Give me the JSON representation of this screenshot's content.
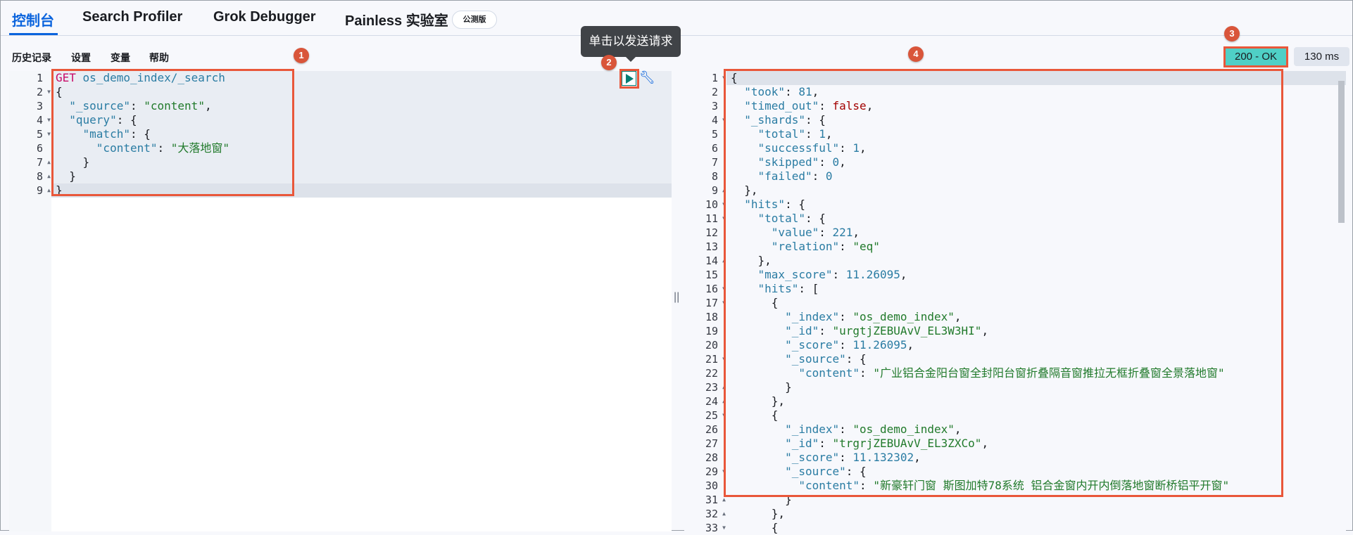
{
  "tabs": [
    {
      "label": "控制台"
    },
    {
      "label": "Search Profiler"
    },
    {
      "label": "Grok Debugger"
    },
    {
      "label": "Painless 实验室"
    }
  ],
  "beta_badge": "公测版",
  "toolbar": {
    "history": "历史记录",
    "settings": "设置",
    "variables": "变量",
    "help": "帮助"
  },
  "tooltip": "单击以发送请求",
  "callouts": [
    "1",
    "2",
    "3",
    "4"
  ],
  "status": {
    "code": "200 - OK",
    "time": "130 ms",
    "color": "#4fd0c6"
  },
  "divider": "||",
  "request": {
    "lines": [
      "GET os_demo_index/_search",
      "{",
      "  \"_source\": \"content\",",
      "  \"query\": {",
      "    \"match\": {",
      "      \"content\": \"大落地窗\"",
      "    }",
      "  }",
      "}"
    ],
    "folds": [
      "",
      "open",
      "",
      "open",
      "open",
      "",
      "close",
      "close",
      "close"
    ]
  },
  "response": {
    "lines": [
      "{",
      "  \"took\": 81,",
      "  \"timed_out\": false,",
      "  \"_shards\": {",
      "    \"total\": 1,",
      "    \"successful\": 1,",
      "    \"skipped\": 0,",
      "    \"failed\": 0",
      "  },",
      "  \"hits\": {",
      "    \"total\": {",
      "      \"value\": 221,",
      "      \"relation\": \"eq\"",
      "    },",
      "    \"max_score\": 11.26095,",
      "    \"hits\": [",
      "      {",
      "        \"_index\": \"os_demo_index\",",
      "        \"_id\": \"urgtjZEBUAvV_EL3W3HI\",",
      "        \"_score\": 11.26095,",
      "        \"_source\": {",
      "          \"content\": \"广业铝合金阳台窗全封阳台窗折叠隔音窗推拉无框折叠窗全景落地窗\"",
      "        }",
      "      },",
      "      {",
      "        \"_index\": \"os_demo_index\",",
      "        \"_id\": \"trgrjZEBUAvV_EL3ZXCo\",",
      "        \"_score\": 11.132302,",
      "        \"_source\": {",
      "          \"content\": \"新豪轩门窗 斯图加特78系统 铝合金窗内开内倒落地窗断桥铝平开窗\"",
      "        }",
      "      },",
      "      {"
    ],
    "folds": [
      "open",
      "",
      "",
      "open",
      "",
      "",
      "",
      "",
      "close",
      "open",
      "open",
      "",
      "",
      "close",
      "",
      "open",
      "open",
      "",
      "",
      "",
      "open",
      "",
      "close",
      "close",
      "open",
      "",
      "",
      "",
      "open",
      "",
      "close",
      "close",
      "open"
    ]
  }
}
